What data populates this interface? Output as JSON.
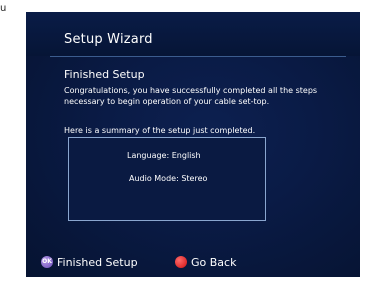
{
  "corner_text": "u",
  "screen": {
    "title": "Setup Wizard",
    "subtitle": "Finished Setup",
    "body": "Congratulations, you have successfully completed all the steps necessary to begin operation of your cable set-top.",
    "summary_heading": "Here is a summary of the setup just completed.",
    "summary": {
      "language_label": "Language:",
      "language_value": "English",
      "audio_label": "Audio Mode:",
      "audio_value": "Stereo"
    }
  },
  "footer": {
    "ok_icon_text": "OK",
    "ok_icon": "ok-button-icon",
    "finish_label": "Finished Setup",
    "back_icon": "red-button-icon",
    "back_label": "Go Back"
  },
  "colors": {
    "background": "#071639",
    "accent_red": "#d01010",
    "accent_purple": "#6a4bb8",
    "box_border": "#8aa6cf"
  }
}
